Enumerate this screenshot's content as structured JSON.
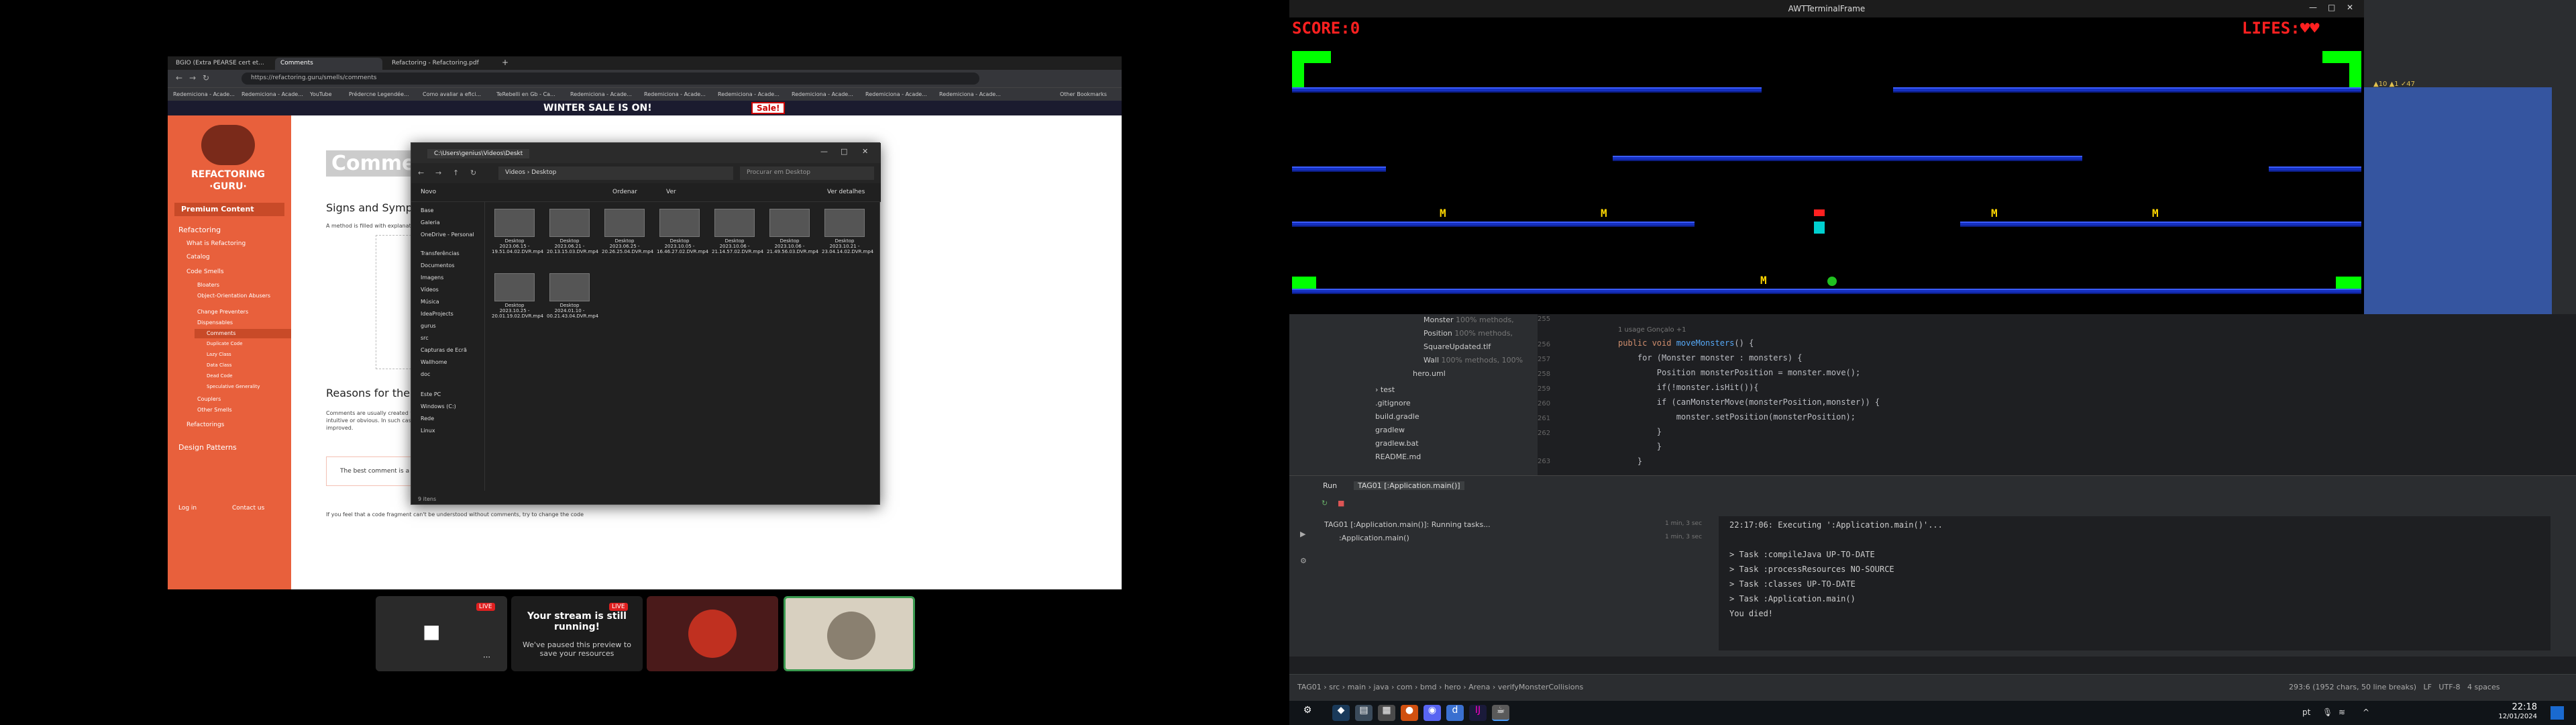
{
  "browser": {
    "tabs": [
      {
        "label": "BGIO (Extra PEARSE cert et..."
      },
      {
        "label": "Comments"
      },
      {
        "label": "Refactoring - Refactoring.pdf"
      }
    ],
    "url": "https://refactoring.guru/smells/comments",
    "bookmarks": [
      "Redemiciona - Acade...",
      "Redemiciona - Acade...",
      "YouTube",
      "Prédercne Legendée...",
      "Como avaliar a efici...",
      "TeRebelli en Gb - Ca...",
      "Redemiciona - Acade...",
      "Redemiciona - Acade...",
      "Redemiciona - Acade...",
      "Redemiciona - Acade...",
      "Redemiciona - Acade...",
      "Redemiciona - Acade...",
      "Other Bookmarks"
    ],
    "promo": "WINTER SALE IS ON!",
    "sale_badge": "Sale!",
    "logo": "REFACTORING",
    "logo_sub": "·GURU·",
    "premium": "Premium Content",
    "side_items": [
      "Refactoring",
      "What is Refactoring",
      "Catalog",
      "Code Smells",
      "Bloaters",
      "Object-Orientation Abusers",
      "Change Preventers",
      "Dispensables",
      "Comments",
      "Duplicate Code",
      "Lazy Class",
      "Data Class",
      "Dead Code",
      "Speculative Generality",
      "Couplers",
      "Other Smells",
      "Refactorings",
      "Design Patterns",
      "Log in",
      "Contact us"
    ],
    "page_title": "Comments",
    "section1": "Signs and Symptoms",
    "sign_text": "A method is filled with explanatory comments.",
    "section2": "Reasons for the Problem",
    "reason_text": "Comments are usually created with the best of intentions, when the author realizes that his or her code isn't intuitive or obvious. In such cases, comments are like a deodorant masking the smell of fishy code that could be improved.",
    "quote": "The best comment is a good name for a method or class.",
    "footer_text": "If you feel that a code fragment can't be understood without comments, try to change the code"
  },
  "explorer": {
    "title": "C:\\Users\\genius\\Videos\\Deskt",
    "path": [
      "Videos",
      "Desktop"
    ],
    "search_placeholder": "Procurar em Desktop",
    "toolbar": [
      "Novo",
      "Ordenar",
      "Ver",
      "Ver detalhes"
    ],
    "nav": [
      "Base",
      "Galeria",
      "OneDrive - Personal",
      "Transferências",
      "Documentos",
      "Imagens",
      "Vídeos",
      "Música",
      "IdeaProjects",
      "gurus",
      "src",
      "Capturas de Ecrã",
      "Wallhome",
      "doc",
      "Este PC",
      "Windows (C:)",
      "Rede",
      "Linux"
    ],
    "files": [
      {
        "name": "Desktop 2023.06.15 - 19.51.04.02.DVR.mp4"
      },
      {
        "name": "Desktop 2023.06.21 - 20.13.15.03.DVR.mp4"
      },
      {
        "name": "Desktop 2023.06.25 - 20.26.25.04.DVR.mp4"
      },
      {
        "name": "Desktop 2023.10.05 - 16.46.27.02.DVR.mp4"
      },
      {
        "name": "Desktop 2023.10.06 - 21.14.57.02.DVR.mp4"
      },
      {
        "name": "Desktop 2023.10.06 - 21.49.56.03.DVR.mp4"
      },
      {
        "name": "Desktop 2023.10.21 - 23.04.14.02.DVR.mp4"
      },
      {
        "name": "Desktop 2023.10.25 - 20.01.19.02.DVR.mp4"
      },
      {
        "name": "Desktop 2024.01.10 - 00.21.43.04.DVR.mp4"
      }
    ],
    "status": "9 itens"
  },
  "stream": {
    "live": "LIVE",
    "title": "Your stream is still running!",
    "subtitle": "We've paused this preview to save your resources"
  },
  "game": {
    "window_title": "AWTTerminalFrame",
    "score": "SCORE:0",
    "lives": "LIFES:",
    "hearts": "♥♥",
    "monster_letter": "M",
    "colors": {
      "platform": "#1530c0",
      "block": "#00ff00",
      "score": "#ff2020",
      "monster": "#ffd700"
    }
  },
  "ide": {
    "tree": [
      {
        "name": "Monster",
        "meta": "100% methods,"
      },
      {
        "name": "Position",
        "meta": "100% methods,"
      },
      {
        "name": "SquareUpdated.tlf",
        "meta": ""
      },
      {
        "name": "Wall",
        "meta": "100% methods, 100%"
      },
      {
        "name": "hero.uml",
        "meta": ""
      },
      {
        "name": "test",
        "meta": ""
      },
      {
        "name": ".gitignore",
        "meta": ""
      },
      {
        "name": "build.gradle",
        "meta": ""
      },
      {
        "name": "gradlew",
        "meta": ""
      },
      {
        "name": "gradlew.bat",
        "meta": ""
      },
      {
        "name": "README.md",
        "meta": ""
      }
    ],
    "usage": "1 usage   Gonçalo +1",
    "line_numbers": [
      "255",
      "256",
      "257",
      "258",
      "259",
      "260",
      "261",
      "262",
      "263"
    ],
    "code": {
      "sig_pre": "public void ",
      "sig_fn": "moveMonsters",
      "sig_post": "() {",
      "l1": "    for (Monster monster : monsters) {",
      "l2": "        Position monsterPosition = monster.move();",
      "l3": "        if(!monster.isHit()){",
      "l4": "        if (canMonsterMove(monsterPosition,monster)) {",
      "l5": "            monster.setPosition(monsterPosition);",
      "l6": "        }",
      "l7": "        }",
      "l8": "    }"
    },
    "run_tab": "Run",
    "run_config": "TAG01 [:Application.main()]",
    "run_tree_1": "TAG01 [:Application.main()]: Running tasks...",
    "run_tree_2": ":Application.main()",
    "run_time_1": "1 min, 3 sec",
    "run_time_2": "1 min, 3 sec",
    "console": [
      "22:17:06: Executing ':Application.main()'...",
      "",
      "> Task :compileJava UP-TO-DATE",
      "> Task :processResources NO-SOURCE",
      "> Task :classes UP-TO-DATE",
      "> Task :Application.main()",
      "You died!"
    ],
    "breadcrumb": [
      "TAG01",
      "src",
      "main",
      "java",
      "com",
      "bmd",
      "hero",
      "Arena",
      "verifyMonsterCollisions"
    ],
    "status_right": "293:6 (1952 chars, 50 line breaks)   LF   UTF-8   4 spaces",
    "warnings": "▲10  ▲1  ✓47"
  },
  "taskbar": {
    "time": "22:18",
    "date": "12/01/2024",
    "lang": "pt"
  }
}
